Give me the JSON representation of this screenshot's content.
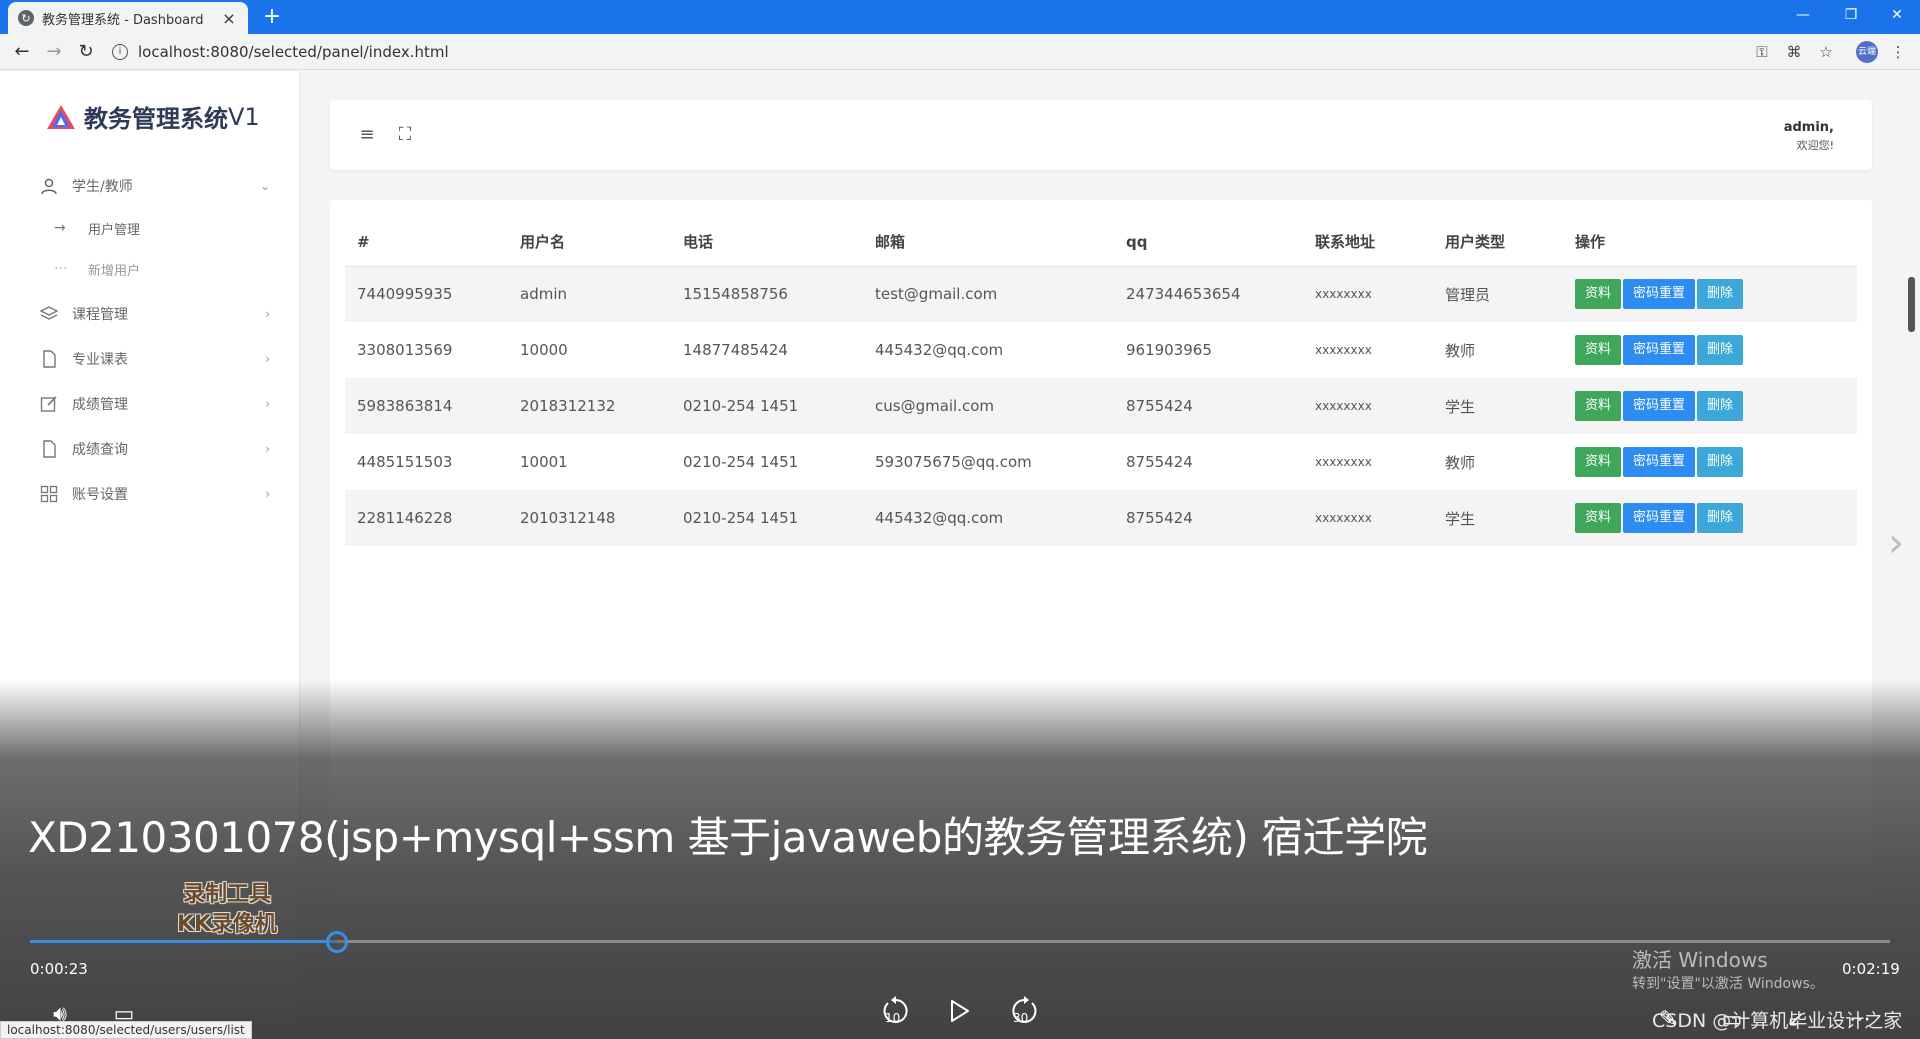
{
  "browser": {
    "tab_title": "教务管理系统 - Dashboard",
    "tab_close": "×",
    "new_tab": "+",
    "url": "localhost:8080/selected/panel/index.html",
    "avatar_text": "云端",
    "status_url": "localhost:8080/selected/users/users/list"
  },
  "sidebar": {
    "logo_name": "教务管理系统",
    "logo_version": "V1",
    "group1": {
      "label": "学生/教师"
    },
    "sub_items": [
      {
        "label": "用户管理"
      },
      {
        "label": "新增用户"
      }
    ],
    "items": [
      {
        "label": "课程管理"
      },
      {
        "label": "专业课表"
      },
      {
        "label": "成绩管理"
      },
      {
        "label": "成绩查询"
      },
      {
        "label": "账号设置"
      }
    ]
  },
  "header": {
    "user_name": "admin,",
    "welcome": "欢迎您!"
  },
  "table": {
    "columns": [
      "#",
      "用户名",
      "电话",
      "邮箱",
      "qq",
      "联系地址",
      "用户类型",
      "操作"
    ],
    "rows": [
      {
        "id": "7440995935",
        "username": "admin",
        "phone": "15154858756",
        "email": "test@gmail.com",
        "qq": "247344653654",
        "address": "xxxxxxxx",
        "type": "管理员"
      },
      {
        "id": "3308013569",
        "username": "10000",
        "phone": "14877485424",
        "email": "445432@qq.com",
        "qq": "961903965",
        "address": "xxxxxxxx",
        "type": "教师"
      },
      {
        "id": "5983863814",
        "username": "2018312132",
        "phone": "0210-254 1451",
        "email": "cus@gmail.com",
        "qq": "8755424",
        "address": "xxxxxxxx",
        "type": "学生"
      },
      {
        "id": "4485151503",
        "username": "10001",
        "phone": "0210-254 1451",
        "email": "593075675@qq.com",
        "qq": "8755424",
        "address": "xxxxxxxx",
        "type": "教师"
      },
      {
        "id": "2281146228",
        "username": "2010312148",
        "phone": "0210-254 1451",
        "email": "445432@qq.com",
        "qq": "8755424",
        "address": "xxxxxxxx",
        "type": "学生"
      }
    ],
    "actions": {
      "profile": "资料",
      "reset": "密码重置",
      "delete": "删除"
    }
  },
  "player": {
    "title": "XD210301078(jsp+mysql+ssm 基于javaweb的教务管理系统) 宿迁学院",
    "watermark_line1": "录制工具",
    "watermark_line2": "KK录像机",
    "current_time": "0:00:23",
    "total_time": "0:02:19",
    "progress": 0.165,
    "rewind_label": "10",
    "forward_label": "30",
    "activate_line1": "激活 Windows",
    "activate_line2": "转到\"设置\"以激活 Windows。",
    "credit": "CSDN @计算机毕业设计之家"
  }
}
